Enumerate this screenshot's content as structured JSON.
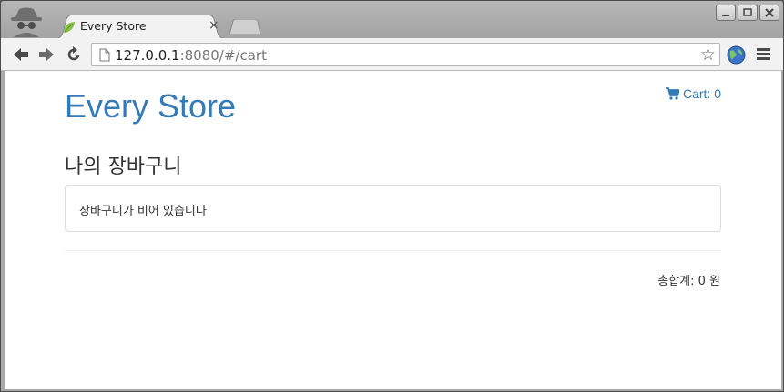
{
  "browser": {
    "tab": {
      "title": "Every Store",
      "close_glyph": "×",
      "favicon": "leaf-icon"
    },
    "address": {
      "host": "127.0.0.1",
      "rest": ":8080/#/cart"
    },
    "icons": [
      "incognito-icon",
      "back-icon",
      "forward-icon",
      "reload-icon",
      "page-icon",
      "star-icon",
      "globe-extension-icon",
      "menu-icon"
    ]
  },
  "page": {
    "store_title": "Every Store",
    "cart_label": "Cart: 0",
    "section_title": "나의 장바구니",
    "empty_message": "장바구니가 비어 있습니다",
    "total_label": "총합계: 0 원"
  },
  "colors": {
    "link": "#337ab7",
    "text": "#333333",
    "border": "#dddddd"
  }
}
